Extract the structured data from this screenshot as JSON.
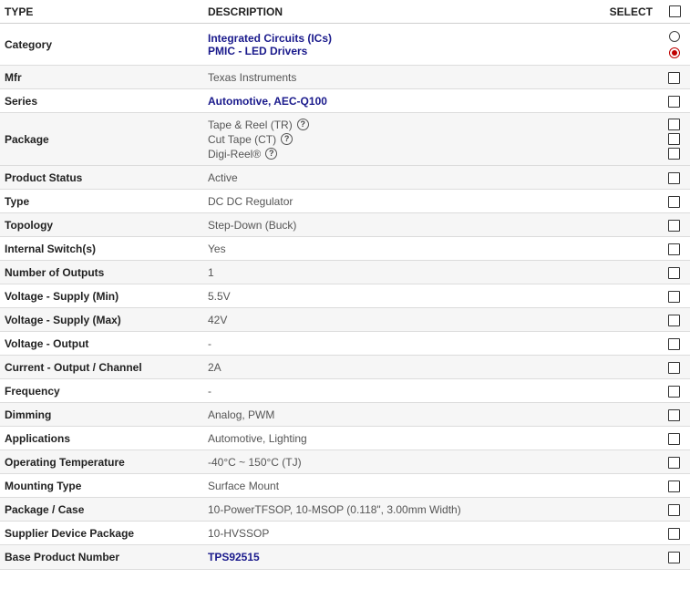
{
  "header": {
    "type": "TYPE",
    "description": "DESCRIPTION",
    "select": "SELECT"
  },
  "category": {
    "name": "Category",
    "links": [
      "Integrated Circuits (ICs)",
      "PMIC - LED Drivers"
    ]
  },
  "mfr": {
    "name": "Mfr",
    "value": "Texas Instruments"
  },
  "series": {
    "name": "Series",
    "value": "Automotive, AEC-Q100"
  },
  "package": {
    "name": "Package",
    "options": [
      "Tape & Reel (TR)",
      "Cut Tape (CT)",
      "Digi-Reel®"
    ],
    "help_glyph": "?"
  },
  "rows": [
    {
      "name": "Product Status",
      "value": "Active"
    },
    {
      "name": "Type",
      "value": "DC DC Regulator"
    },
    {
      "name": "Topology",
      "value": "Step-Down (Buck)"
    },
    {
      "name": "Internal Switch(s)",
      "value": "Yes"
    },
    {
      "name": "Number of Outputs",
      "value": "1"
    },
    {
      "name": "Voltage - Supply (Min)",
      "value": "5.5V"
    },
    {
      "name": "Voltage - Supply (Max)",
      "value": "42V"
    },
    {
      "name": "Voltage - Output",
      "value": "-"
    },
    {
      "name": "Current - Output / Channel",
      "value": "2A"
    },
    {
      "name": "Frequency",
      "value": "-"
    },
    {
      "name": "Dimming",
      "value": "Analog, PWM"
    },
    {
      "name": "Applications",
      "value": "Automotive, Lighting"
    },
    {
      "name": "Operating Temperature",
      "value": "-40°C ~ 150°C (TJ)"
    },
    {
      "name": "Mounting Type",
      "value": "Surface Mount"
    },
    {
      "name": "Package / Case",
      "value": "10-PowerTFSOP, 10-MSOP (0.118\", 3.00mm Width)"
    },
    {
      "name": "Supplier Device Package",
      "value": "10-HVSSOP"
    }
  ],
  "base_product": {
    "name": "Base Product Number",
    "value": "TPS92515"
  },
  "colors": {
    "link": "#1a1a8c",
    "radio_selected": "#c00000",
    "row_alt": "#f6f6f6"
  }
}
